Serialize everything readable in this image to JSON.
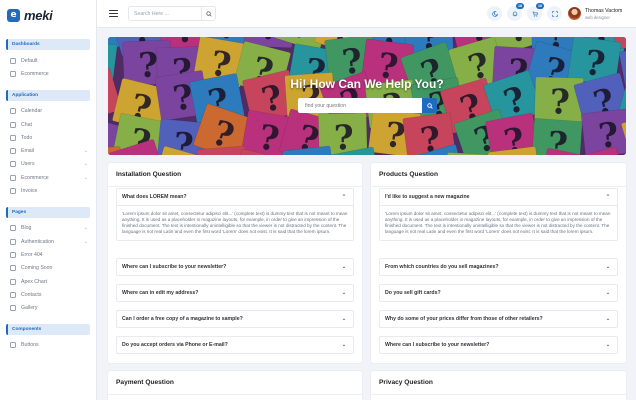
{
  "app": {
    "logo_text": "meki"
  },
  "topbar": {
    "search_placeholder": "Search Here ...",
    "notification_count": "18",
    "cart_count": "10",
    "user_name": "Thomas Vactom",
    "user_role": "web designer"
  },
  "sidebar": {
    "sections": [
      {
        "label": "Dashboards",
        "items": [
          {
            "label": "Default",
            "chevron": false
          },
          {
            "label": "Ecommerce",
            "chevron": false
          }
        ]
      },
      {
        "label": "Application",
        "items": [
          {
            "label": "Calendar",
            "chevron": false
          },
          {
            "label": "Chat",
            "chevron": false
          },
          {
            "label": "Todo",
            "chevron": false
          },
          {
            "label": "Email",
            "chevron": true
          },
          {
            "label": "Users",
            "chevron": true
          },
          {
            "label": "Ecommerce",
            "chevron": true
          },
          {
            "label": "Invoice",
            "chevron": false
          }
        ]
      },
      {
        "label": "Pages",
        "items": [
          {
            "label": "Blog",
            "chevron": true
          },
          {
            "label": "Authentication",
            "chevron": true
          },
          {
            "label": "Error 404",
            "chevron": false
          },
          {
            "label": "Coming Soon",
            "chevron": false
          },
          {
            "label": "Apex Chart",
            "chevron": false
          },
          {
            "label": "Contacts",
            "chevron": false
          },
          {
            "label": "Gallery",
            "chevron": false
          }
        ]
      },
      {
        "label": "Components",
        "items": [
          {
            "label": "Buttons",
            "chevron": false
          }
        ]
      }
    ]
  },
  "hero": {
    "title": "Hi! How Can We Help You?",
    "search_placeholder": "find your question"
  },
  "faq": {
    "installation": {
      "title": "Installation Question",
      "open": {
        "question": "What does LOREM mean?",
        "answer": "'Lorem ipsum dolor sit amet, consectetur adipisci elit...' (complete text) is dummy text that is not meant to mean anything. It is used as a placeholder in magazine layouts, for example, in order to give an impression of the finished document. The text is intentionally unintelligible so that the viewer is not distracted by the content. The language is not real Latin and even the first word 'Lorem' does not exist. It is said that the lorem ipsum."
      },
      "questions": [
        "Where can I subscribe to your newsletter?",
        "Where can in edit my address?",
        "Can I order a free copy of a magazine to sample?",
        "Do you accept orders via Phone or E-mail?"
      ]
    },
    "products": {
      "title": "Products Question",
      "open": {
        "question": "I'd like to suggest a new magazine",
        "answer": "'Lorem ipsum dolor sit amet, consectetur adipisci elit...' (complete text) is dummy text that is not meant to mean anything. It is used as a placeholder in magazine layouts, for example, in order to give an impression of the finished document. The text is intentionally unintelligible so that the viewer is not distracted by the content. The language is not real Latin and even the first word 'Lorem' does not exist. It is said that the lorem ipsum."
      },
      "questions": [
        "From which countries do you sell magazines?",
        "Do you sell gift cards?",
        "Why do some of your prices differ from those of other retailers?",
        "Where can I subscribe to your newsletter?"
      ]
    },
    "payment": {
      "title": "Payment Question"
    },
    "privacy": {
      "title": "Privacy Question"
    }
  },
  "colors": {
    "accent": "#1e6bbf",
    "section_bg": "#dde9f7",
    "page_bg": "#f1f3f8"
  }
}
